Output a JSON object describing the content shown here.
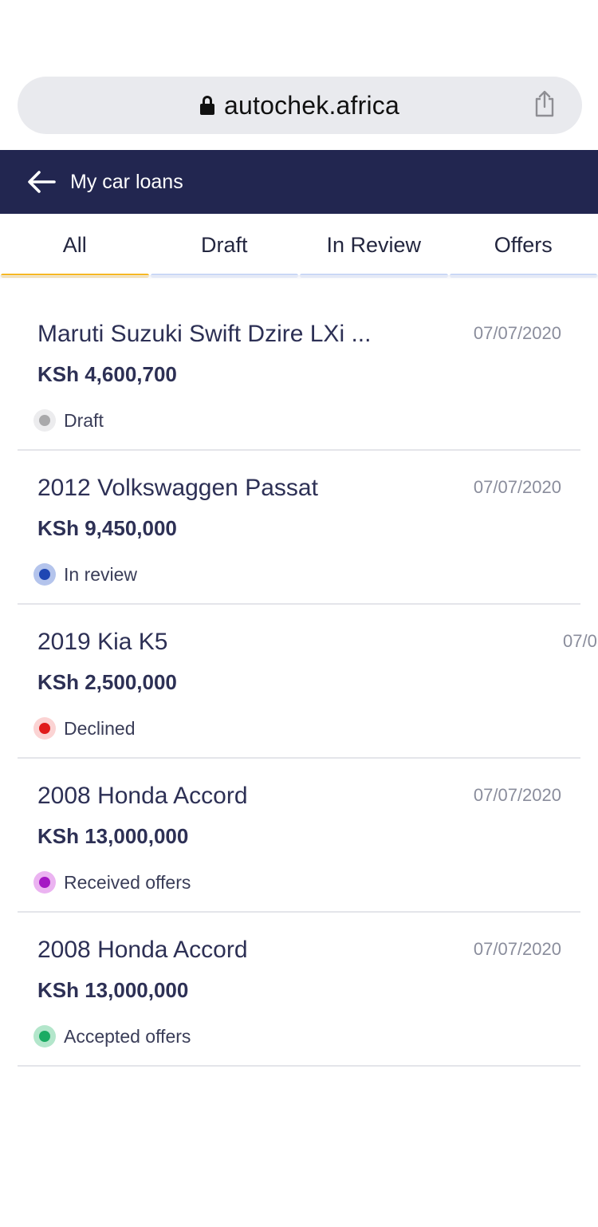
{
  "browser": {
    "url": "autochek.africa"
  },
  "header": {
    "title": "My car loans"
  },
  "tabs": [
    {
      "label": "All",
      "active": true
    },
    {
      "label": "Draft",
      "active": false
    },
    {
      "label": "In Review",
      "active": false
    },
    {
      "label": "Offers",
      "active": false
    }
  ],
  "loans": [
    {
      "title": "Maruti Suzuki Swift Dzire LXi ...",
      "date": "07/07/2020",
      "amount": "KSh 4,600,700",
      "status": "Draft",
      "status_color": "#a9a9ab",
      "status_halo": "#ececee"
    },
    {
      "title": "2012 Volkswaggen Passat",
      "date": "07/07/2020",
      "amount": "KSh 9,450,000",
      "status": "In review",
      "status_color": "#1f47b3",
      "status_halo": "#b4c4ec"
    },
    {
      "title": "2019 Kia K5",
      "date": "07/0",
      "amount": "KSh 2,500,000",
      "status": "Declined",
      "status_color": "#e01b1b",
      "status_halo": "#fbd3d3"
    },
    {
      "title": "2008 Honda Accord",
      "date": "07/07/2020",
      "amount": "KSh 13,000,000",
      "status": "Received offers",
      "status_color": "#a517c4",
      "status_halo": "#ebb3f1"
    },
    {
      "title": "2008 Honda Accord",
      "date": "07/07/2020",
      "amount": "KSh 13,000,000",
      "status": "Accepted offers",
      "status_color": "#1bab63",
      "status_halo": "#b3e6cb"
    }
  ]
}
